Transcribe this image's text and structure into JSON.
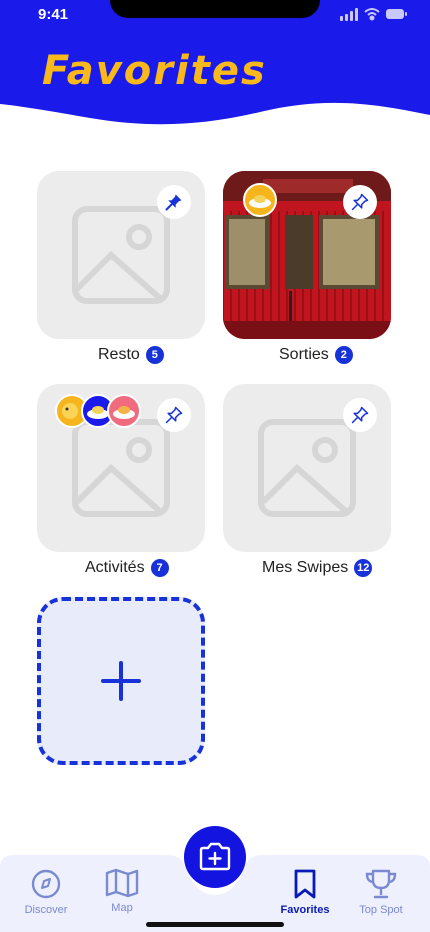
{
  "status_bar": {
    "time": "9:41"
  },
  "header": {
    "title": "Favorites"
  },
  "cards": [
    {
      "label": "Resto",
      "count": "5"
    },
    {
      "label": "Sorties",
      "count": "2"
    },
    {
      "label": "Activités",
      "count": "7"
    },
    {
      "label": "Mes Swipes",
      "count": "12"
    }
  ],
  "tabbar": {
    "discover": "Discover",
    "map": "Map",
    "favorites": "Favorites",
    "top_spot": "Top Spot"
  },
  "colors": {
    "primary": "#1a1aeb",
    "accent": "#f9b81b",
    "card": "#ececec"
  }
}
